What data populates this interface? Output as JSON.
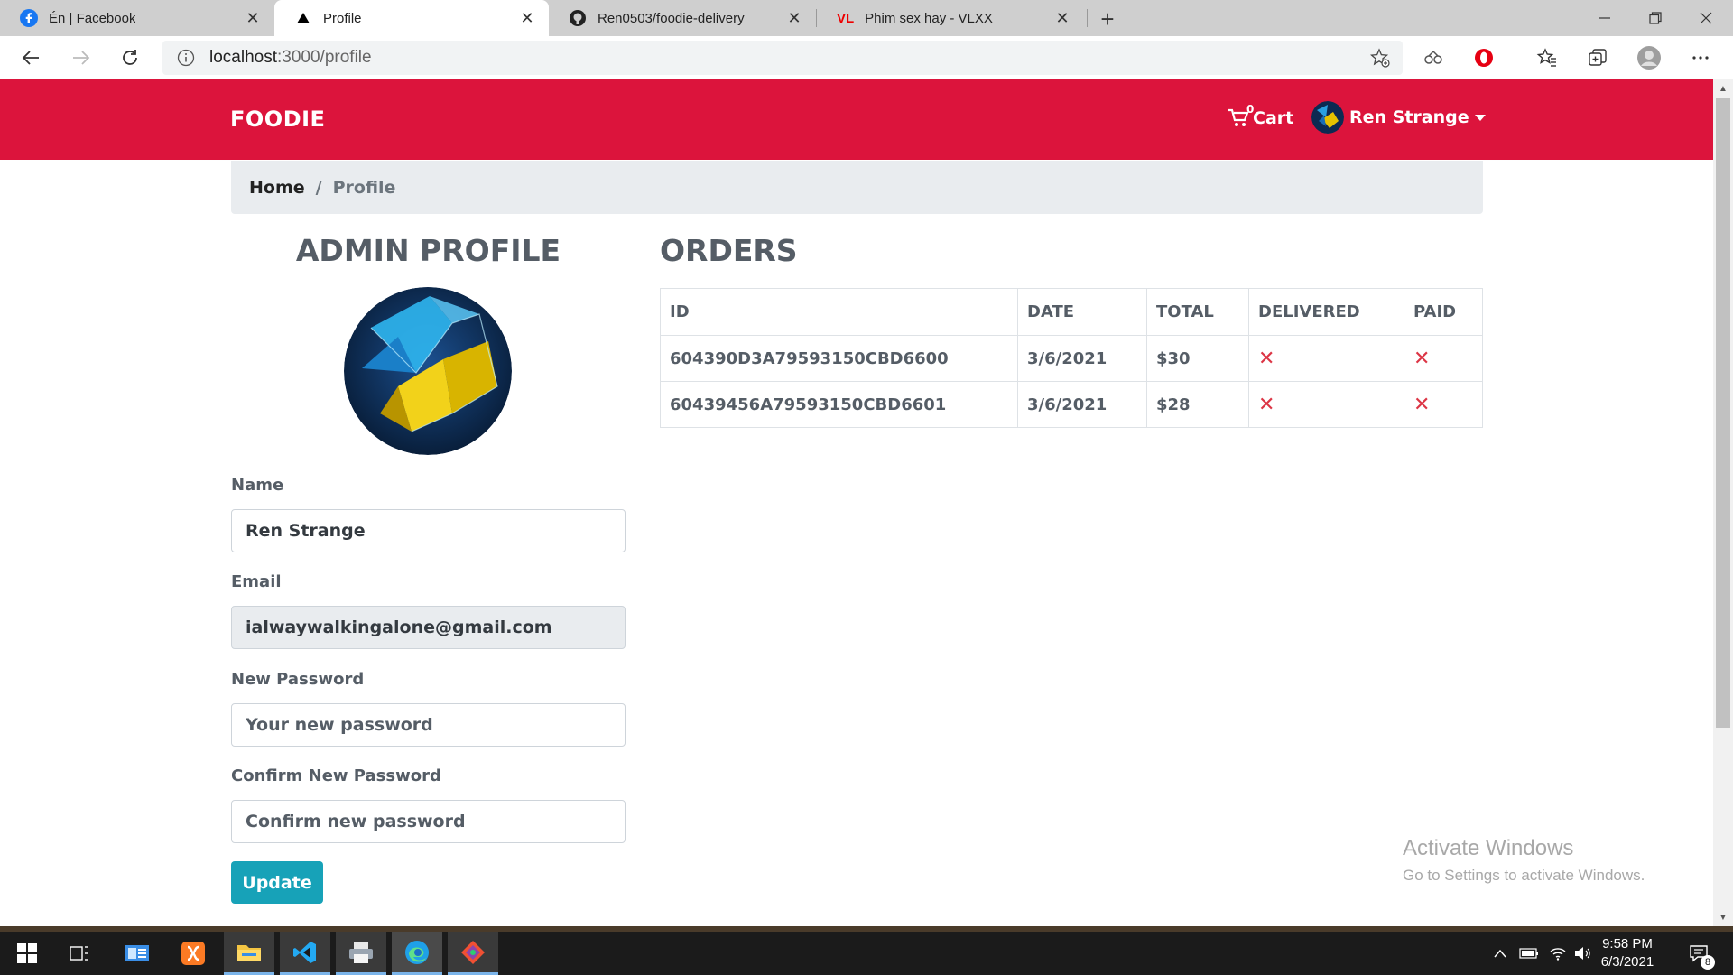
{
  "browser": {
    "tabs": [
      {
        "title": "Én | Facebook",
        "icon": "facebook-icon"
      },
      {
        "title": "Profile",
        "icon": "vercel-triangle-icon"
      },
      {
        "title": "Ren0503/foodie-delivery",
        "icon": "github-icon"
      },
      {
        "title": "Phim sex hay - VLXX",
        "icon": "vl-icon",
        "icon_text": "VL"
      }
    ],
    "active_tab": 1,
    "url_host": "localhost",
    "url_path": ":3000/profile"
  },
  "navbar": {
    "brand": "FOODIE",
    "cart_label": "Cart",
    "cart_count": "0",
    "user_name": "Ren Strange",
    "color": "#dc143c"
  },
  "breadcrumb": {
    "home": "Home",
    "separator": "/",
    "current": "Profile"
  },
  "profile": {
    "title": "ADMIN PROFILE",
    "name_label": "Name",
    "name_value": "Ren Strange",
    "email_label": "Email",
    "email_value": "ialwaywalkingalone@gmail.com",
    "new_password_label": "New Password",
    "new_password_placeholder": "Your new password",
    "confirm_password_label": "Confirm New Password",
    "confirm_password_placeholder": "Confirm new password",
    "update_button": "Update",
    "button_color": "#17a2b8"
  },
  "orders": {
    "title": "ORDERS",
    "columns": [
      "ID",
      "DATE",
      "TOTAL",
      "DELIVERED",
      "PAID"
    ],
    "rows": [
      {
        "id": "604390D3A79593150CBD6600",
        "date": "3/6/2021",
        "total": "$30",
        "delivered": "✕",
        "paid": "✕"
      },
      {
        "id": "60439456A79593150CBD6601",
        "date": "3/6/2021",
        "total": "$28",
        "delivered": "✕",
        "paid": "✕"
      }
    ]
  },
  "watermark": {
    "title": "Activate Windows",
    "subtitle": "Go to Settings to activate Windows."
  },
  "taskbar": {
    "time": "9:58 PM",
    "date": "6/3/2021",
    "notification_count": "8"
  }
}
